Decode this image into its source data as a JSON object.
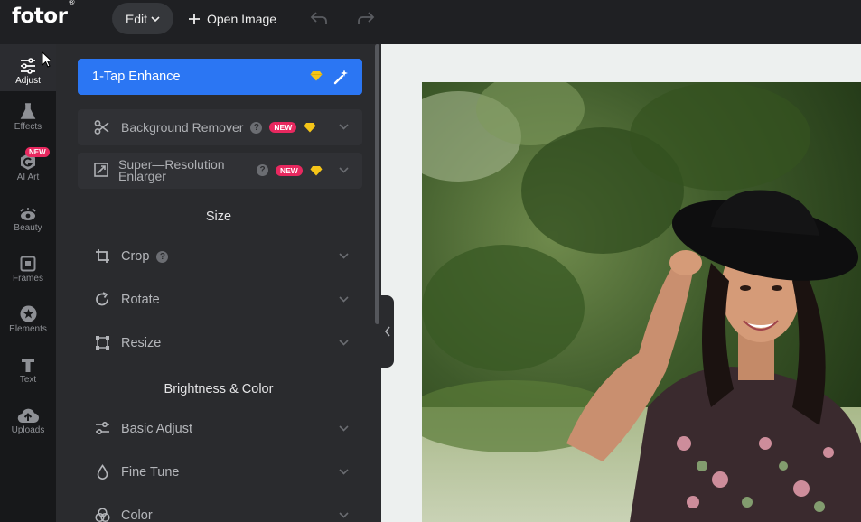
{
  "header": {
    "logo": "fotor",
    "logo_mark": "®",
    "edit_label": "Edit",
    "open_image_label": "Open Image"
  },
  "rail": {
    "items": [
      {
        "label": "Adjust",
        "icon": "sliders-icon",
        "active": true
      },
      {
        "label": "Effects",
        "icon": "flask-icon"
      },
      {
        "label": "AI Art",
        "icon": "ai-art-icon",
        "badge": "NEW"
      },
      {
        "label": "Beauty",
        "icon": "eye-icon"
      },
      {
        "label": "Frames",
        "icon": "frame-icon"
      },
      {
        "label": "Elements",
        "icon": "star-icon"
      },
      {
        "label": "Text",
        "icon": "text-icon"
      },
      {
        "label": "Uploads",
        "icon": "cloud-upload-icon"
      }
    ]
  },
  "panel": {
    "enhance_label": "1-Tap Enhance",
    "features": [
      {
        "label": "Background Remover",
        "badge": "NEW"
      },
      {
        "label_line1": "Super—Resolution",
        "label_line2": "Enlarger",
        "badge": "NEW"
      }
    ],
    "size_title": "Size",
    "size_tools": [
      "Crop",
      "Rotate",
      "Resize"
    ],
    "color_title": "Brightness & Color",
    "color_tools": [
      "Basic Adjust",
      "Fine Tune",
      "Color"
    ]
  },
  "colors": {
    "accent": "#2b76f3",
    "badge": "#e8285f",
    "gem": "#f5c518"
  }
}
